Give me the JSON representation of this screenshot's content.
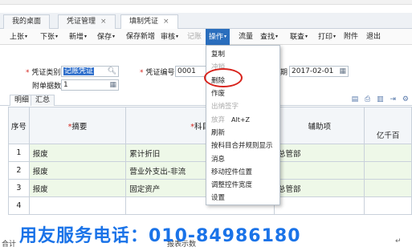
{
  "tabs": [
    {
      "label": "我的桌面"
    },
    {
      "label": "凭证管理",
      "close": "×"
    },
    {
      "label": "填制凭证",
      "close": "×"
    }
  ],
  "toolbar": {
    "items": [
      "上张",
      "下张",
      "新增",
      "保存",
      "保存新增",
      "审核",
      "记账",
      "操作",
      "流量",
      "查找",
      "联查",
      "打印",
      "附件",
      "退出"
    ],
    "caret": "▾"
  },
  "form": {
    "voucher_type_label": "凭证类别",
    "voucher_type_value": "记账凭证",
    "voucher_no_label": "凭证编号",
    "voucher_no_value": "0001",
    "date_label_partial": "期",
    "date_value": "2017-02-01",
    "attachments_label": "附单据数",
    "attachments_value": "1",
    "required_mark": "*"
  },
  "subtabs": [
    "明细",
    "汇总"
  ],
  "grid": {
    "headers": {
      "seq": "序号",
      "summary": "摘要",
      "account": "科目",
      "aux": "辅助项",
      "money": "亿千百"
    },
    "rows": [
      {
        "seq": "1",
        "summary": "报废",
        "account": "累计折旧",
        "aux": "总管部"
      },
      {
        "seq": "2",
        "summary": "报废",
        "account": "营业外支出-非流",
        "aux": ""
      },
      {
        "seq": "3",
        "summary": "报废",
        "account": "固定资产",
        "aux": "总管部"
      },
      {
        "seq": "4",
        "summary": "",
        "account": "",
        "aux": ""
      }
    ]
  },
  "menu": {
    "items": [
      {
        "label": "复制",
        "enabled": true
      },
      {
        "label": "冲销",
        "enabled": false
      },
      {
        "label": "删除",
        "enabled": true
      },
      {
        "label": "作废",
        "enabled": true
      },
      {
        "label": "出纳签字",
        "enabled": false
      },
      {
        "label": "放弃",
        "enabled": false,
        "shortcut": "Alt+Z"
      },
      {
        "label": "刷新",
        "enabled": true
      },
      {
        "label": "按科目合并规则显示",
        "enabled": true
      },
      {
        "label": "消息",
        "enabled": true
      },
      {
        "label": "移动控件位置",
        "enabled": true
      },
      {
        "label": "调整控件宽度",
        "enabled": true
      },
      {
        "label": "设置",
        "enabled": true
      }
    ]
  },
  "footer": {
    "hotline": "用友服务电话：010-84986180",
    "left_text": "合计",
    "mid_text": "报表示数"
  },
  "colors": {
    "accent": "#2a6ebd",
    "highlight_circle": "#d8231c",
    "hotline": "#1a73e8",
    "row_bg": "#eef8e8"
  }
}
